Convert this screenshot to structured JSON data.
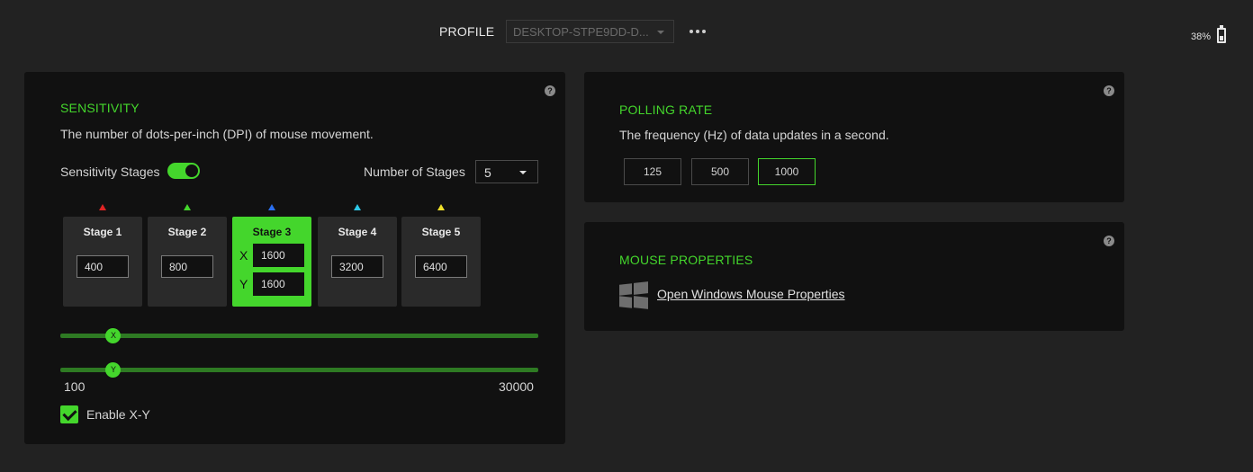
{
  "header": {
    "profile_label": "PROFILE",
    "profile_value": "DESKTOP-STPE9DD-D...",
    "more_icon": "ellipsis-icon",
    "battery_text": "38%",
    "battery_icon": "battery-icon"
  },
  "sensitivity": {
    "title": "SENSITIVITY",
    "description": "The number of dots-per-inch (DPI) of mouse movement.",
    "stages_label": "Sensitivity Stages",
    "stages_enabled": true,
    "num_stages_label": "Number of Stages",
    "num_stages_value": "5",
    "active_stage": 3,
    "stages": [
      {
        "name": "Stage 1",
        "value": "400",
        "color": "#e02424"
      },
      {
        "name": "Stage 2",
        "value": "800",
        "color": "#44d62c"
      },
      {
        "name": "Stage 3",
        "x_label": "X",
        "x_value": "1600",
        "y_label": "Y",
        "y_value": "1600",
        "color": "#2a6ff0"
      },
      {
        "name": "Stage 4",
        "value": "3200",
        "color": "#2ec8e8"
      },
      {
        "name": "Stage 5",
        "value": "6400",
        "color": "#f0e02a"
      }
    ],
    "slider_x_label": "X",
    "slider_y_label": "Y",
    "slider_x_value": 1600,
    "slider_y_value": 1600,
    "range_min": "100",
    "range_max": "30000",
    "enable_xy_label": "Enable X-Y",
    "enable_xy_checked": true
  },
  "polling": {
    "title": "POLLING RATE",
    "description": "The frequency (Hz) of data updates in a second.",
    "options": [
      "125",
      "500",
      "1000"
    ],
    "selected": "1000"
  },
  "mouse_properties": {
    "title": "MOUSE PROPERTIES",
    "link_label": "Open Windows Mouse Properties",
    "icon": "windows-logo-icon"
  },
  "colors": {
    "accent": "#44d62c",
    "panel_bg": "#111111",
    "page_bg": "#222222"
  }
}
